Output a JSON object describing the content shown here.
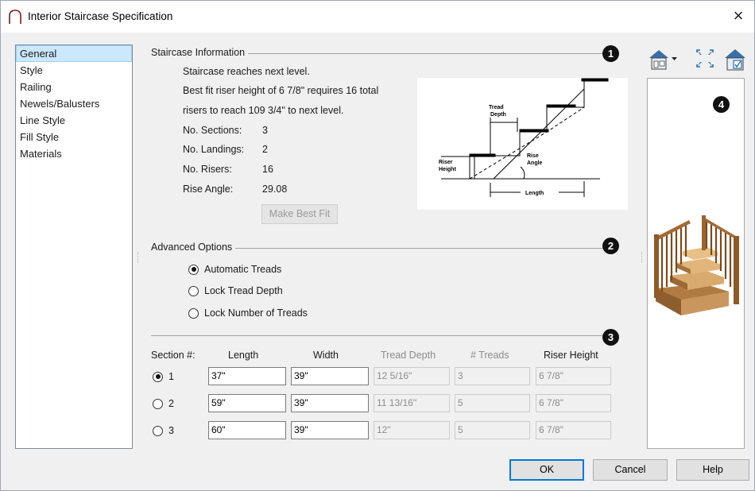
{
  "window": {
    "title": "Interior Staircase Specification",
    "close_glyph": "×"
  },
  "nav": {
    "items": [
      {
        "label": "General",
        "selected": true
      },
      {
        "label": "Style"
      },
      {
        "label": "Railing"
      },
      {
        "label": "Newels/Balusters"
      },
      {
        "label": "Line Style"
      },
      {
        "label": "Fill Style"
      },
      {
        "label": "Materials"
      }
    ]
  },
  "staircase_info": {
    "title": "Staircase Information",
    "badge": "1",
    "line1": "Staircase reaches next level.",
    "line2": "Best fit riser height of 6 7/8\" requires 16 total",
    "line3": "risers to reach 109 3/4\" to next level.",
    "sections_label": "No. Sections:",
    "sections_value": "3",
    "landings_label": "No. Landings:",
    "landings_value": "2",
    "risers_label": "No. Risers:",
    "risers_value": "16",
    "angle_label": "Rise Angle:",
    "angle_value": "29.08",
    "best_fit_button": "Make Best Fit"
  },
  "diagram": {
    "tread_label_1": "Tread",
    "tread_label_2": "Depth",
    "riser_label_1": "Riser",
    "riser_label_2": "Height",
    "rise_label_1": "Rise",
    "rise_label_2": "Angle",
    "length_label": "Length"
  },
  "advanced": {
    "title": "Advanced Options",
    "badge": "2",
    "options": [
      {
        "label": "Automatic Treads",
        "checked": true
      },
      {
        "label": "Lock Tread Depth",
        "checked": false
      },
      {
        "label": "Lock Number of Treads",
        "checked": false
      }
    ]
  },
  "sections_table": {
    "badge": "3",
    "headers": {
      "section": "Section #:",
      "length": "Length",
      "width": "Width",
      "tread_depth": "Tread Depth",
      "treads": "# Treads",
      "riser_height": "Riser Height"
    },
    "rows": [
      {
        "num": "1",
        "selected": true,
        "length": "37\"",
        "width": "39\"",
        "tread_depth": "12 5/16\"",
        "treads": "3",
        "riser_height": "6 7/8\""
      },
      {
        "num": "2",
        "selected": false,
        "length": "59\"",
        "width": "39\"",
        "tread_depth": "11 13/16\"",
        "treads": "5",
        "riser_height": "6 7/8\""
      },
      {
        "num": "3",
        "selected": false,
        "length": "60\"",
        "width": "39\"",
        "tread_depth": "12\"",
        "treads": "5",
        "riser_height": "6 7/8\""
      }
    ]
  },
  "preview": {
    "badge": "4"
  },
  "buttons": {
    "ok": "OK",
    "cancel": "Cancel",
    "help": "Help"
  },
  "colors": {
    "selection_bg": "#cce8ff",
    "wood": "#c8955a",
    "default_button_border": "#0078d7"
  }
}
